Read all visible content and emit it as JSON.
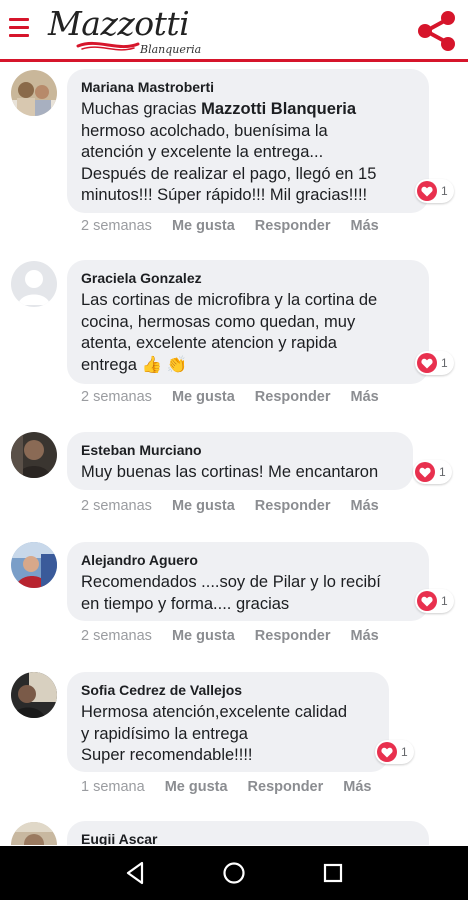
{
  "header": {
    "brand": "Mazzotti",
    "brand_sub": "Blanqueria"
  },
  "comments": [
    {
      "author": "Mariana Mastroberti",
      "text_before": "Muchas gracias ",
      "text_bold": "Mazzotti Blanqueria",
      "text_after": "\nhermoso acolchado, buenísima la\natención y excelente la entrega...\nDespués de realizar el pago, llegó en 15\nminutos!!! Súper rápido!!! Mil gracias!!!!",
      "reactions": "1",
      "time": "2 semanas",
      "like": "Me gusta",
      "reply": "Responder",
      "more": "Más"
    },
    {
      "author": "Graciela Gonzalez",
      "text": "Las cortinas de microfibra y la cortina de\ncocina, hermosas como quedan, muy\natenta, excelente atencion y rapida\nentrega",
      "emoji": "👍 👏",
      "reactions": "1",
      "time": "2 semanas",
      "like": "Me gusta",
      "reply": "Responder",
      "more": "Más"
    },
    {
      "author": "Esteban Murciano",
      "text": "Muy buenas las cortinas! Me encantaron",
      "reactions": "1",
      "time": "2 semanas",
      "like": "Me gusta",
      "reply": "Responder",
      "more": "Más"
    },
    {
      "author": "Alejandro Aguero",
      "text": "Recomendados ....soy de Pilar y lo recibí\nen tiempo y forma.... gracias",
      "reactions": "1",
      "time": "2 semanas",
      "like": "Me gusta",
      "reply": "Responder",
      "more": "Más"
    },
    {
      "author": "Sofia Cedrez de Vallejos",
      "text": "Hermosa atención,excelente calidad\ny rapidísimo la entrega\nSuper recomendable!!!!",
      "reactions": "1",
      "time": "1 semana",
      "like": "Me gusta",
      "reply": "Responder",
      "more": "Más"
    },
    {
      "author": "Eugii Ascar"
    }
  ],
  "colors": {
    "brand_red": "#d6152b",
    "heart": "#e8304e",
    "bubble": "#eff0f3"
  }
}
